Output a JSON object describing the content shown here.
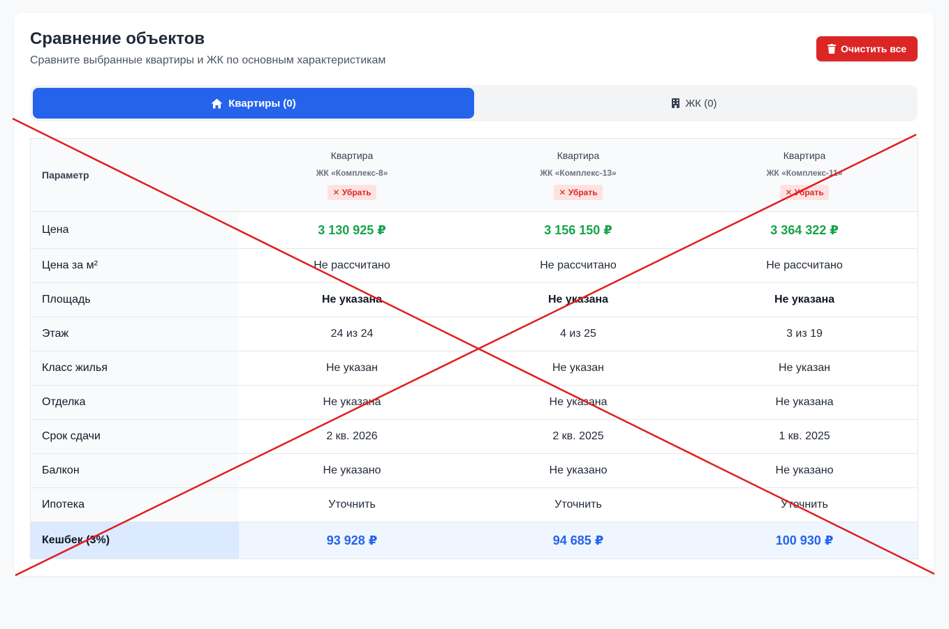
{
  "header": {
    "title": "Сравнение объектов",
    "subtitle": "Сравните выбранные квартиры и ЖК по основным характеристикам",
    "clear_label": "Очистить все"
  },
  "tabs": [
    {
      "label": "Квартиры (0)",
      "icon": "home-icon",
      "active": true
    },
    {
      "label": "ЖК (0)",
      "icon": "building-icon",
      "active": false
    }
  ],
  "table": {
    "param_header": "Параметр",
    "columns": [
      {
        "type": "Квартира",
        "complex": "ЖК «Комплекс-8»",
        "remove_label": "✕ Убрать"
      },
      {
        "type": "Квартира",
        "complex": "ЖК «Комплекс-13»",
        "remove_label": "✕ Убрать"
      },
      {
        "type": "Квартира",
        "complex": "ЖК «Комплекс-11»",
        "remove_label": "✕ Убрать"
      }
    ],
    "rows": [
      {
        "label": "Цена",
        "values": [
          "3 130 925 ₽",
          "3 156 150 ₽",
          "3 364 322 ₽"
        ]
      },
      {
        "label": "Цена за м²",
        "values": [
          "Не рассчитано",
          "Не рассчитано",
          "Не рассчитано"
        ]
      },
      {
        "label": "Площадь",
        "values": [
          "Не указана",
          "Не указана",
          "Не указана"
        ]
      },
      {
        "label": "Этаж",
        "values": [
          "24 из 24",
          "4 из 25",
          "3 из 19"
        ]
      },
      {
        "label": "Класс жилья",
        "values": [
          "Не указан",
          "Не указан",
          "Не указан"
        ]
      },
      {
        "label": "Отделка",
        "values": [
          "Не указана",
          "Не указана",
          "Не указана"
        ]
      },
      {
        "label": "Срок сдачи",
        "values": [
          "2 кв. 2026",
          "2 кв. 2025",
          "1 кв. 2025"
        ]
      },
      {
        "label": "Балкон",
        "values": [
          "Не указано",
          "Не указано",
          "Не указано"
        ]
      },
      {
        "label": "Ипотека",
        "values": [
          "Уточнить",
          "Уточнить",
          "Уточнить"
        ]
      },
      {
        "label": "Кешбек (3%)",
        "values": [
          "93 928 ₽",
          "94 685 ₽",
          "100 930 ₽"
        ]
      }
    ]
  },
  "colors": {
    "accent": "#2563eb",
    "danger": "#dc2626",
    "price": "#16a34a",
    "overlay_cross": "#e11d1d"
  }
}
